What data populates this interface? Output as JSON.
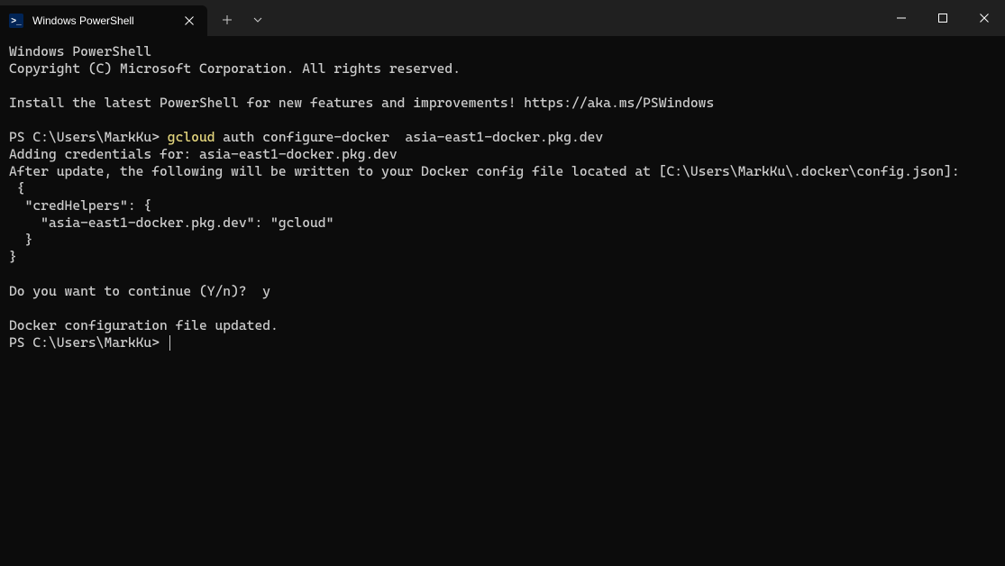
{
  "titlebar": {
    "tab": {
      "title": "Windows PowerShell",
      "iconText": ">_"
    }
  },
  "terminal": {
    "header1": "Windows PowerShell",
    "header2": "Copyright (C) Microsoft Corporation. All rights reserved.",
    "installMsg": "Install the latest PowerShell for new features and improvements! https://aka.ms/PSWindows",
    "prompt1": "PS C:\\Users\\MarkKu> ",
    "cmdPart1": "gcloud",
    "cmdPart2": " auth configure-docker  asia-east1-docker.pkg.dev",
    "out1": "Adding credentials for: asia-east1-docker.pkg.dev",
    "out2": "After update, the following will be written to your Docker config file located at [C:\\Users\\MarkKu\\.docker\\config.json]:",
    "out3": " {",
    "out4": "  \"credHelpers\": {",
    "out5": "    \"asia-east1-docker.pkg.dev\": \"gcloud\"",
    "out6": "  }",
    "out7": "}",
    "confirm": "Do you want to continue (Y/n)?  y",
    "done": "Docker configuration file updated.",
    "prompt2": "PS C:\\Users\\MarkKu> "
  }
}
